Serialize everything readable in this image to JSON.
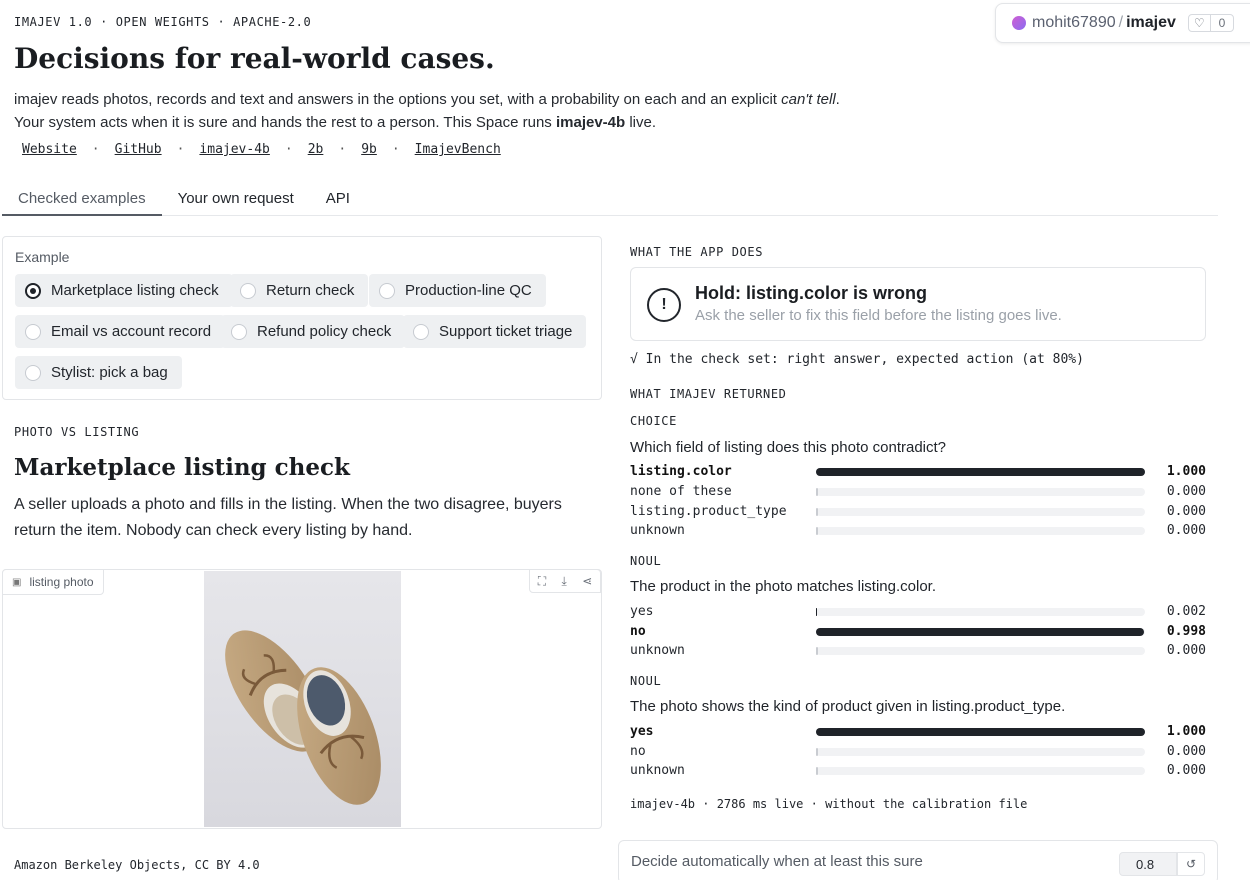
{
  "header": {
    "eyebrow": "IMAJEV 1.0 · OPEN WEIGHTS · APACHE-2.0",
    "title": "Decisions for real-world cases.",
    "intro_a": "imajev reads photos, records and text and answers in the options you set, with a probability on each and an explicit ",
    "intro_em": "can't tell",
    "intro_b": ". Your system acts when it is sure and hands the rest to a person. This Space runs ",
    "intro_strong": "imajev-4b",
    "intro_c": " live.",
    "links": [
      "Website",
      "GitHub",
      "imajev-4b",
      "2b",
      "9b",
      "ImajevBench"
    ],
    "link_separator": "·"
  },
  "user_badge": {
    "user": "mohit67890",
    "separator": "/",
    "repo": "imajev",
    "likes": "0"
  },
  "tabs": [
    {
      "label": "Checked examples",
      "active": true
    },
    {
      "label": "Your own request",
      "active": false
    },
    {
      "label": "API",
      "active": false
    }
  ],
  "picker": {
    "label": "Example",
    "options": [
      "Marketplace listing check",
      "Return check",
      "Production-line QC",
      "Email vs account record",
      "Refund policy check",
      "Support ticket triage",
      "Stylist: pick a bag"
    ],
    "selected": "Marketplace listing check"
  },
  "case": {
    "eyebrow": "PHOTO VS LISTING",
    "title": "Marketplace listing check",
    "description": "A seller uploads a photo and fills in the listing. When the two disagree, buyers return the item. Nobody can check every listing by hand.",
    "image_label": "listing photo",
    "credit": "Amazon Berkeley Objects, CC BY 4.0"
  },
  "app_action": {
    "eyebrow": "WHAT THE APP DOES",
    "headline": "Hold: listing.color is wrong",
    "subtext": "Ask the seller to fix this field before the listing goes live.",
    "check_set": "√ In the check set: right answer, expected action (at 80%)"
  },
  "returned": {
    "eyebrow": "WHAT IMAJEV RETURNED",
    "blocks": [
      {
        "kind": "CHOICE",
        "question": "Which field of listing does this photo contradict?",
        "rows": [
          {
            "label": "listing.color",
            "value": "1.000",
            "p": 1.0,
            "top": true
          },
          {
            "label": "none of these",
            "value": "0.000",
            "p": 0.0,
            "top": false
          },
          {
            "label": "listing.product_type",
            "value": "0.000",
            "p": 0.0,
            "top": false
          },
          {
            "label": "unknown",
            "value": "0.000",
            "p": 0.0,
            "top": false
          }
        ]
      },
      {
        "kind": "NOUL",
        "question": "The product in the photo matches listing.color.",
        "rows": [
          {
            "label": "yes",
            "value": "0.002",
            "p": 0.002,
            "top": false
          },
          {
            "label": "no",
            "value": "0.998",
            "p": 0.998,
            "top": true
          },
          {
            "label": "unknown",
            "value": "0.000",
            "p": 0.0,
            "top": false
          }
        ]
      },
      {
        "kind": "NOUL",
        "question": "The photo shows the kind of product given in listing.product_type.",
        "rows": [
          {
            "label": "yes",
            "value": "1.000",
            "p": 1.0,
            "top": true
          },
          {
            "label": "no",
            "value": "0.000",
            "p": 0.0,
            "top": false
          },
          {
            "label": "unknown",
            "value": "0.000",
            "p": 0.0,
            "top": false
          }
        ]
      }
    ],
    "meta": "imajev-4b · 2786 ms live · without the calibration file"
  },
  "threshold": {
    "label": "Decide automatically when at least this sure",
    "value": "0.8"
  },
  "icons": {
    "avatar": "gradient-dot",
    "like": "heart-icon",
    "image": "image-icon",
    "fullscreen": "fullscreen-icon",
    "download": "download-icon",
    "share": "share-icon",
    "warning": "exclamation-circle-icon",
    "reset": "reset-icon"
  }
}
